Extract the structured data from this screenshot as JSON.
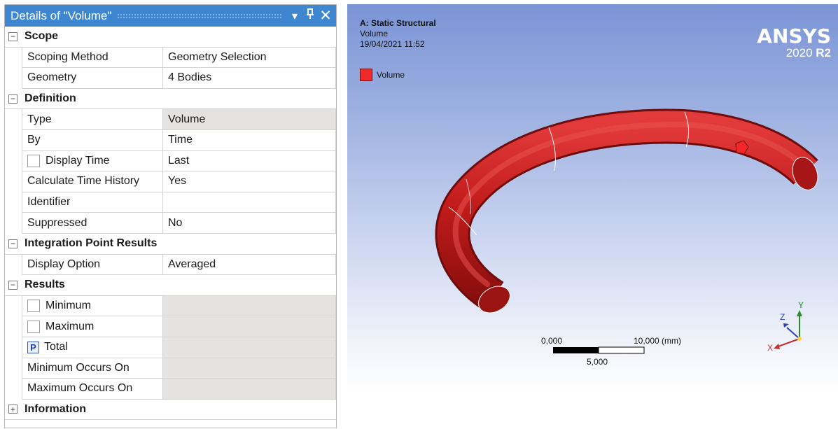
{
  "details": {
    "title": "Details of \"Volume\"",
    "pin_glyph": "▾",
    "pin2_glyph": "■",
    "close_glyph": "✕",
    "sections": [
      {
        "toggle": "−",
        "label": "Scope",
        "rows": [
          {
            "label": "Scoping Method",
            "value": "Geometry Selection",
            "grey": false,
            "prefix": ""
          },
          {
            "label": "Geometry",
            "value": "4 Bodies",
            "grey": false,
            "prefix": ""
          }
        ]
      },
      {
        "toggle": "−",
        "label": "Definition",
        "rows": [
          {
            "label": "Type",
            "value": "Volume",
            "grey": true,
            "prefix": ""
          },
          {
            "label": "By",
            "value": "Time",
            "grey": false,
            "prefix": ""
          },
          {
            "label": "Display Time",
            "value": "Last",
            "grey": false,
            "prefix": "checkbox"
          },
          {
            "label": "Calculate Time History",
            "value": "Yes",
            "grey": false,
            "prefix": ""
          },
          {
            "label": "Identifier",
            "value": "",
            "grey": false,
            "prefix": ""
          },
          {
            "label": "Suppressed",
            "value": "No",
            "grey": false,
            "prefix": ""
          }
        ]
      },
      {
        "toggle": "−",
        "label": "Integration Point Results",
        "rows": [
          {
            "label": "Display Option",
            "value": "Averaged",
            "grey": false,
            "prefix": ""
          }
        ]
      },
      {
        "toggle": "−",
        "label": "Results",
        "rows": [
          {
            "label": "Minimum",
            "value": "",
            "grey": true,
            "prefix": "checkbox"
          },
          {
            "label": "Maximum",
            "value": "",
            "grey": true,
            "prefix": "checkbox"
          },
          {
            "label": "Total",
            "value": "",
            "grey": true,
            "prefix": "P"
          },
          {
            "label": "Minimum Occurs On",
            "value": "",
            "grey": true,
            "prefix": ""
          },
          {
            "label": "Maximum Occurs On",
            "value": "",
            "grey": true,
            "prefix": ""
          }
        ]
      },
      {
        "toggle": "+",
        "label": "Information",
        "rows": []
      }
    ]
  },
  "viewport": {
    "analysis_title": "A: Static Structural",
    "result_name": "Volume",
    "timestamp": "19/04/2021 11:52",
    "legend_label": "Volume",
    "legend_color": "#ee2b2b",
    "brand": "ANSYS",
    "version_year": "2020",
    "version_release": "R2",
    "scale_left": "0,000",
    "scale_right": "10,000 (mm)",
    "scale_mid": "5,000",
    "axis_x": "X",
    "axis_y": "Y",
    "axis_z": "Z",
    "model_color": "#c81f1f"
  }
}
